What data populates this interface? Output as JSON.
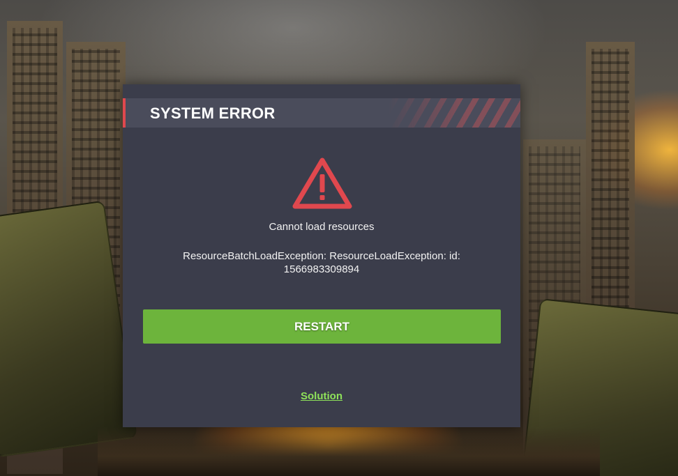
{
  "dialog": {
    "title": "SYSTEM ERROR",
    "message": "Cannot load resources",
    "detail": "ResourceBatchLoadException: ResourceLoadException: id: 1566983309894",
    "restart_label": "RESTART",
    "solution_label": "Solution",
    "icon": "warning-icon"
  },
  "colors": {
    "dialog_bg": "#3b3d4b",
    "titlebar_bg": "#4a4c5b",
    "accent_red": "#e0484e",
    "button_green": "#6db43c",
    "link_green": "#8fe35a"
  }
}
